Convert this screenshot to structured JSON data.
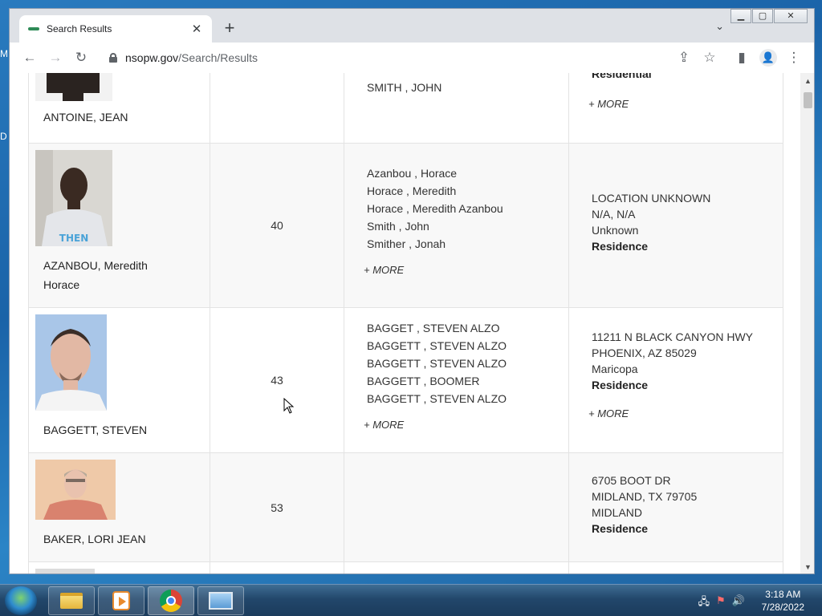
{
  "desktop": {
    "left_glyphs": [
      "M",
      "D"
    ]
  },
  "browser": {
    "tab": {
      "title": "Search Results"
    },
    "url": {
      "domain": "nsopw.gov",
      "path": "/Search/Results"
    },
    "icons": {
      "back": "←",
      "forward": "→",
      "reload": "↻",
      "share": "⇪",
      "star": "☆",
      "sidepanel": "▮",
      "menu": "⋮",
      "new_tab": "+",
      "close": "✕",
      "tab_search": "⌄",
      "profile": "👤"
    }
  },
  "results": {
    "more_label": "+ MORE",
    "rows": [
      {
        "name_lines": [
          "ANTOINE, JEAN"
        ],
        "age": "",
        "aliases": [
          "SMITH , JOHN"
        ],
        "location": [],
        "location_type": "Residential",
        "has_alias_more": false,
        "has_loc_more": true,
        "photo": "partial"
      },
      {
        "name_lines": [
          "AZANBOU, Meredith",
          "Horace"
        ],
        "age": "40",
        "aliases": [
          "Azanbou , Horace",
          "Horace , Meredith",
          "Horace , Meredith Azanbou",
          "Smith , John",
          "Smither , Jonah"
        ],
        "location": [
          "LOCATION UNKNOWN",
          "N/A, N/A",
          "Unknown"
        ],
        "location_type": "Residence",
        "has_alias_more": true,
        "has_loc_more": false
      },
      {
        "name_lines": [
          "BAGGETT, STEVEN"
        ],
        "age": "43",
        "aliases": [
          "BAGGET , STEVEN ALZO",
          "BAGGETT , STEVEN ALZO",
          "BAGGETT , STEVEN ALZO",
          "BAGGETT , BOOMER",
          "BAGGETT , STEVEN ALZO"
        ],
        "location": [
          "11211 N BLACK CANYON HWY",
          "PHOENIX, AZ  85029",
          "Maricopa"
        ],
        "location_type": "Residence",
        "has_alias_more": true,
        "has_loc_more": true
      },
      {
        "name_lines": [
          "BAKER, LORI JEAN"
        ],
        "age": "53",
        "aliases": [],
        "location": [
          "6705 BOOT DR",
          "MIDLAND, TX  79705",
          "MIDLAND"
        ],
        "location_type": "Residence",
        "has_alias_more": false,
        "has_loc_more": false
      }
    ]
  },
  "taskbar": {
    "apps": [
      "file-explorer",
      "media-player",
      "chrome",
      "remote-desktop"
    ],
    "clock_time": "3:18 AM",
    "clock_date": "7/28/2022"
  },
  "colors": {
    "desktop_blue": "#1a63a8",
    "tab_strip": "#dee1e6",
    "row_alt": "#f8f8f8"
  }
}
